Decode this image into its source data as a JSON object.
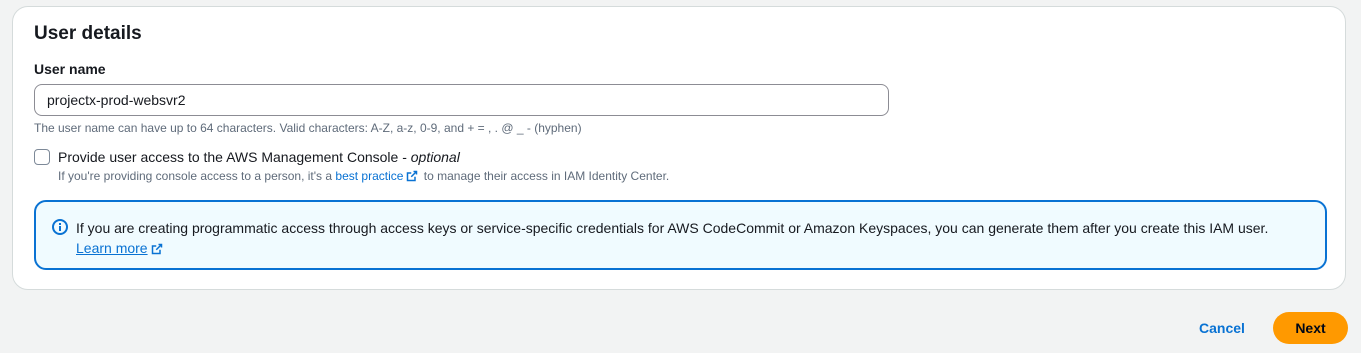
{
  "user_details": {
    "title": "User details",
    "user_name": {
      "label": "User name",
      "value": "projectx-prod-websvr2",
      "constraint": "The user name can have up to 64 characters. Valid characters: A-Z, a-z, 0-9, and + = , . @ _ - (hyphen)"
    },
    "console_access": {
      "checked": false,
      "label": "Provide user access to the AWS Management Console - ",
      "optional": "optional",
      "desc_before": "If you're providing console access to a person, it's a ",
      "link_text": "best practice",
      "desc_after": " to manage their access in IAM Identity Center."
    },
    "info_alert": {
      "text": "If you are creating programmatic access through access keys or service-specific credentials for AWS CodeCommit or Amazon Keyspaces, you can generate them after you create this IAM user.",
      "link_text": "Learn more"
    }
  },
  "footer": {
    "cancel_label": "Cancel",
    "next_label": "Next"
  },
  "colors": {
    "primary_button": "#ff9900",
    "link": "#0972d3",
    "info_border": "#0972d3",
    "info_bg": "#f0fbff"
  },
  "icons": {
    "external_link": "external-link-icon",
    "info": "info-icon"
  }
}
